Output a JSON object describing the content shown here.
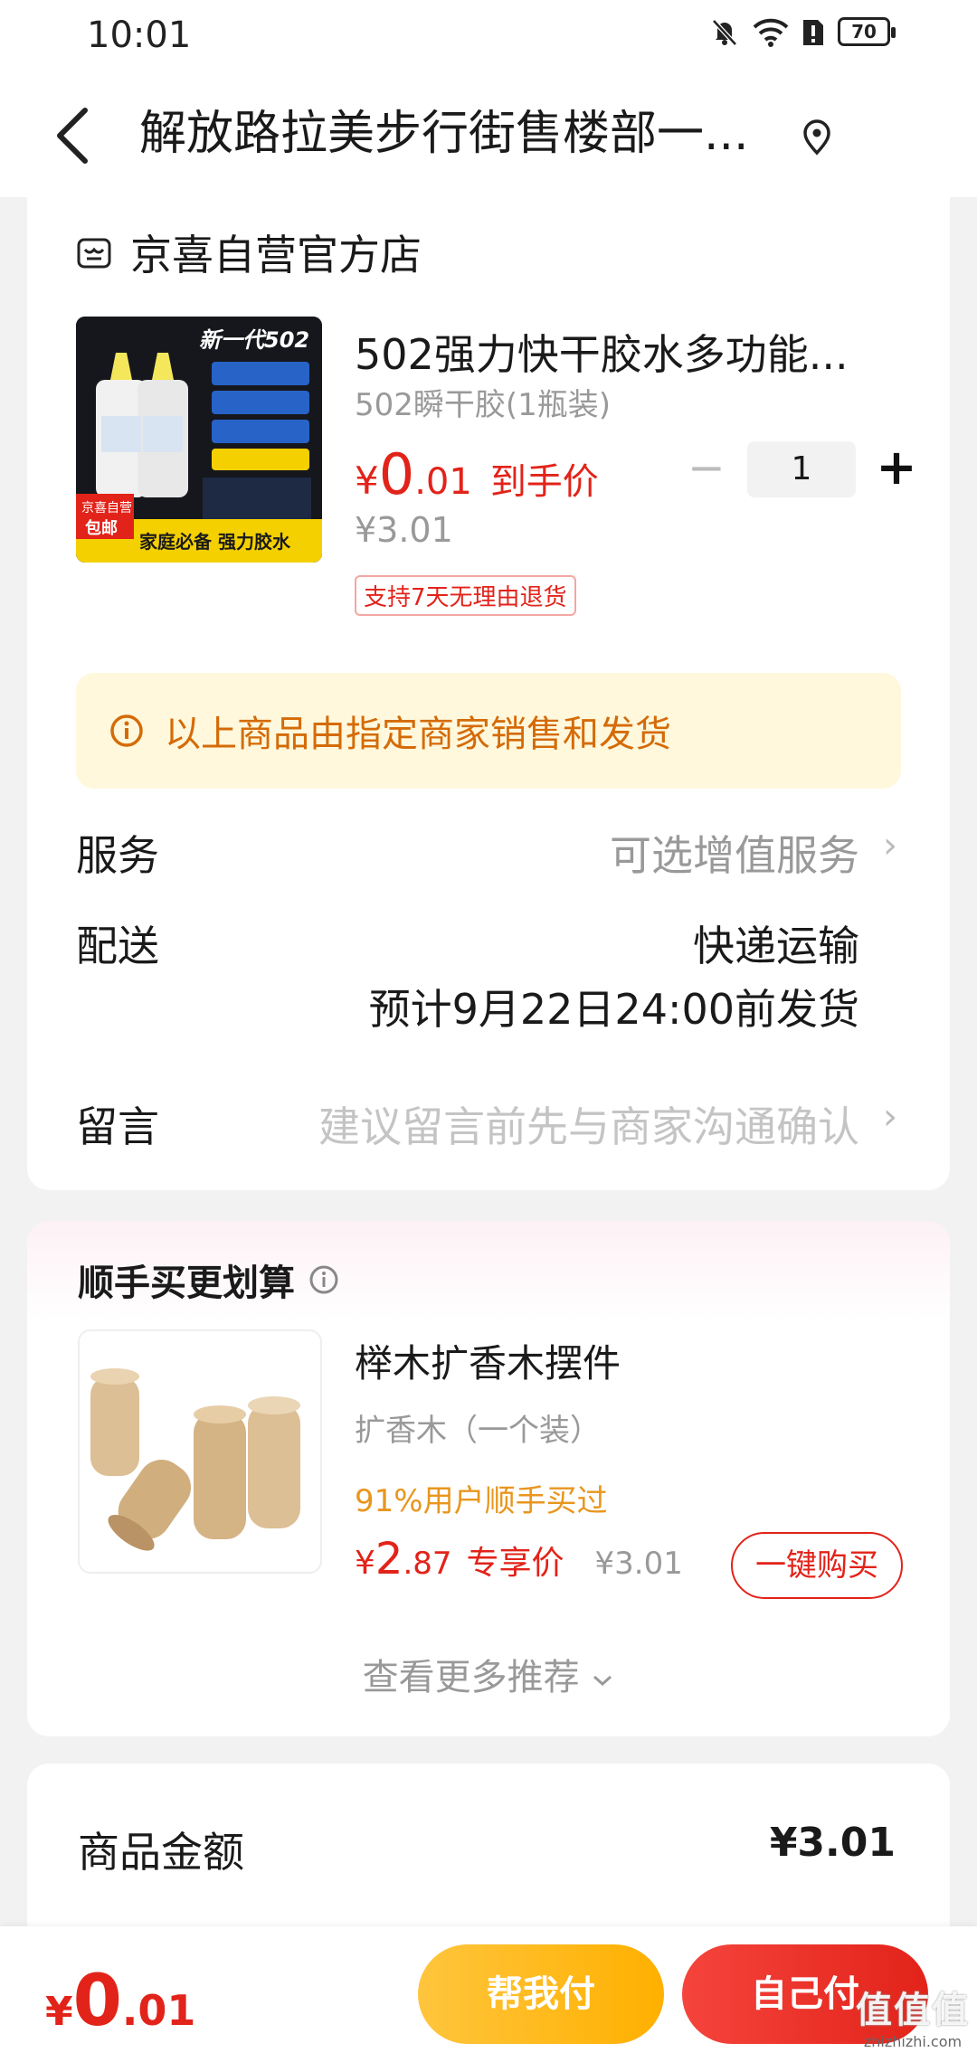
{
  "status_bar": {
    "time": "10:01",
    "battery": "70"
  },
  "header": {
    "title": "解放路拉美步行街售楼部一..."
  },
  "store": {
    "name": "京喜自营官方店"
  },
  "product": {
    "image_text": {
      "top": "新一代502",
      "badge_top": "京喜自营",
      "badge_bottom": "包邮",
      "bottom": "家庭必备 强力胶水"
    },
    "title": "502强力快干胶水多功能...",
    "spec": "502瞬干胶(1瓶装)",
    "price": {
      "yen": "¥",
      "int": "0",
      "dec": ".01",
      "tag": "到手价"
    },
    "original_price": "¥3.01",
    "return_badge": "支持7天无理由退货",
    "quantity": "1",
    "minus": "−",
    "plus": "+"
  },
  "notice": {
    "text": "以上商品由指定商家销售和发货"
  },
  "service": {
    "label": "服务",
    "value": "可选增值服务"
  },
  "delivery": {
    "label": "配送",
    "method": "快递运输",
    "eta": "预计9月22日24:00前发货"
  },
  "message": {
    "label": "留言",
    "placeholder": "建议留言前先与商家沟通确认"
  },
  "recommend": {
    "title": "顺手买更划算",
    "item": {
      "title": "榉木扩香木摆件",
      "spec": "扩香木（一个装）",
      "hint": "91%用户顺手买过",
      "price": {
        "yen": "¥",
        "int": "2",
        "dec": ".87",
        "tag": "专享价",
        "orig": "¥3.01"
      },
      "buy_label": "一键购买"
    },
    "more_label": "查看更多推荐"
  },
  "summary": {
    "label": "商品金额",
    "value": "¥3.01"
  },
  "bottom_bar": {
    "total": {
      "yen": "¥",
      "int": "0",
      "dec": ".01"
    },
    "help_pay_label": "帮我付",
    "self_pay_label": "自己付"
  },
  "watermark": {
    "main": "值值值",
    "sub": "zhizhizhi.com"
  },
  "colors": {
    "price_red": "#e2231a",
    "notice_bg": "#fff8dc",
    "notice_text": "#d46b08",
    "help_btn": "#ffb000",
    "self_btn": "#e2231a"
  }
}
